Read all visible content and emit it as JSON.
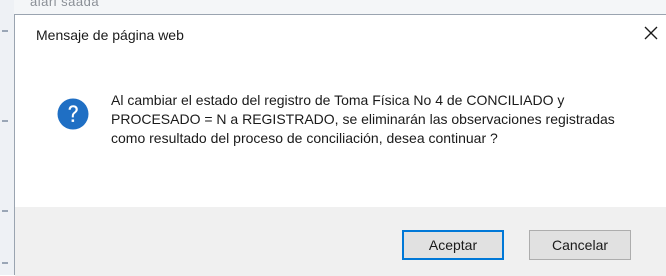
{
  "background": {
    "partial_text": "alarl saada"
  },
  "dialog": {
    "title": "Mensaje de página web",
    "close_icon": "close-icon",
    "message_icon": "question-icon",
    "message": "Al cambiar el estado del registro de Toma Física No 4 de CONCILIADO y PROCESADO = N a REGISTRADO, se eliminarán las observaciones registradas como resultado del proceso de conciliación, desea continuar ?",
    "buttons": {
      "accept_label": "Aceptar",
      "cancel_label": "Cancelar"
    }
  },
  "colors": {
    "accent": "#0078d7",
    "question_icon": "#1f6fc4",
    "footer_bg": "#f0f0f0"
  }
}
